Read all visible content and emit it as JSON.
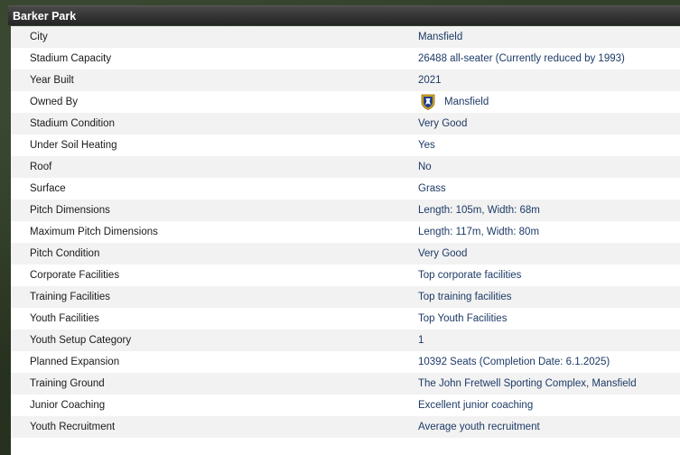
{
  "panel": {
    "title": "Barker Park"
  },
  "rows": [
    {
      "label": "City",
      "value": "Mansfield"
    },
    {
      "label": "Stadium Capacity",
      "value": "26488 all-seater (Currently reduced by 1993)"
    },
    {
      "label": "Year Built",
      "value": "2021"
    },
    {
      "label": "Owned By",
      "value": "Mansfield",
      "icon": "club-crest-icon"
    },
    {
      "label": "Stadium Condition",
      "value": "Very Good"
    },
    {
      "label": "Under Soil Heating",
      "value": "Yes"
    },
    {
      "label": "Roof",
      "value": "No"
    },
    {
      "label": "Surface",
      "value": "Grass"
    },
    {
      "label": "Pitch Dimensions",
      "value": "Length: 105m, Width: 68m"
    },
    {
      "label": "Maximum Pitch Dimensions",
      "value": "Length: 117m, Width: 80m"
    },
    {
      "label": "Pitch Condition",
      "value": "Very Good"
    },
    {
      "label": "Corporate Facilities",
      "value": "Top corporate facilities"
    },
    {
      "label": "Training Facilities",
      "value": "Top training facilities"
    },
    {
      "label": "Youth Facilities",
      "value": "Top Youth Facilities"
    },
    {
      "label": "Youth Setup Category",
      "value": "1"
    },
    {
      "label": "Planned Expansion",
      "value": "10392 Seats (Completion Date: 6.1.2025)"
    },
    {
      "label": "Training Ground",
      "value": "The John Fretwell Sporting Complex, Mansfield"
    },
    {
      "label": "Junior Coaching",
      "value": "Excellent junior coaching"
    },
    {
      "label": "Youth Recruitment",
      "value": "Average youth recruitment"
    }
  ],
  "colors": {
    "header_bg": "#333333",
    "row_alt_bg": "#f2f2f2",
    "value_text": "#1d3a66",
    "crest_blue": "#1f3f8f",
    "crest_gold": "#d9a520"
  }
}
